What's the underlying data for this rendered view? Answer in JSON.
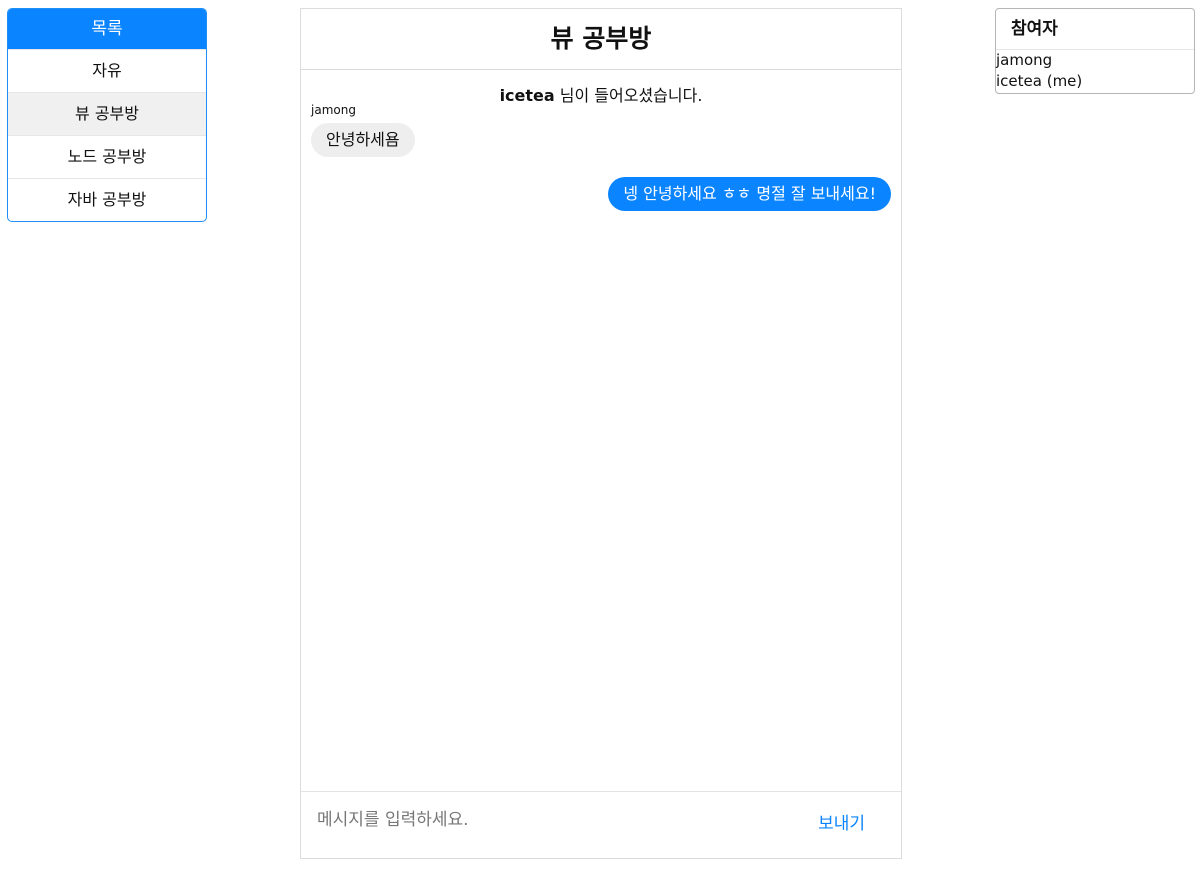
{
  "room_list": {
    "header": "목록",
    "items": [
      {
        "label": "자유",
        "active": false
      },
      {
        "label": "뷰 공부방",
        "active": true
      },
      {
        "label": "노드 공부방",
        "active": false
      },
      {
        "label": "자바 공부방",
        "active": false
      }
    ]
  },
  "chat": {
    "title": "뷰 공부방",
    "system_message": {
      "user": "icetea",
      "text": "님이 들어오셨습니다."
    },
    "messages": [
      {
        "sender": "jamong",
        "text": "안녕하세욤",
        "mine": false
      },
      {
        "sender": "icetea",
        "text": "넹 안녕하세요 ㅎㅎ 명절 잘 보내세요!",
        "mine": true
      }
    ],
    "composer": {
      "placeholder": "메시지를 입력하세요.",
      "value": "",
      "send_label": "보내기"
    }
  },
  "participants": {
    "title": "참여자",
    "list": [
      "jamong",
      "icetea (me)"
    ]
  },
  "colors": {
    "accent": "#0a84ff",
    "bubble_other": "#eeeeee",
    "active_item": "#f0f0f0"
  }
}
